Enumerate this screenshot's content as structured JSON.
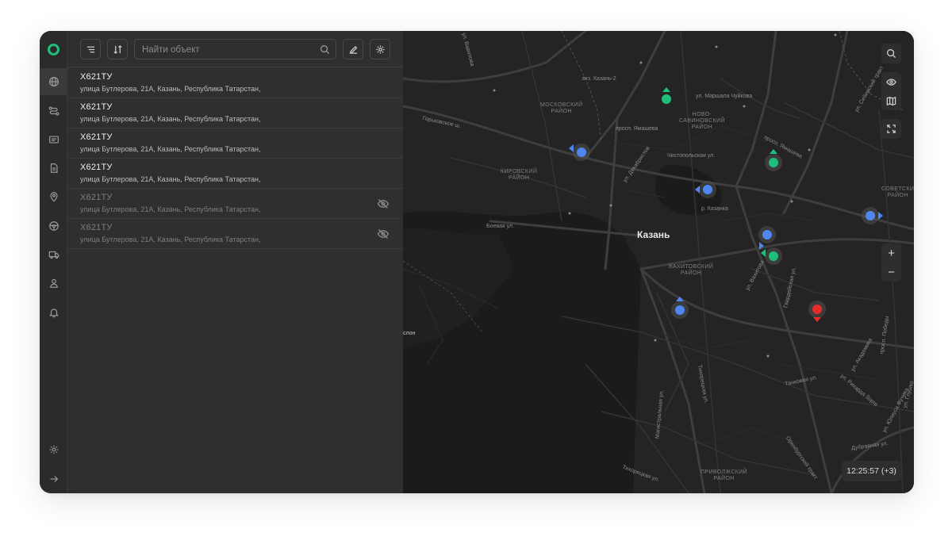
{
  "search": {
    "placeholder": "Найти объект",
    "value": ""
  },
  "objects": [
    {
      "plate": "Х621ТУ",
      "address": "улица Бутлерова, 21А, Казань, Республика Татарстан,",
      "hidden": false
    },
    {
      "plate": "Х621ТУ",
      "address": "улица Бутлерова, 21А, Казань, Республика Татарстан,",
      "hidden": false
    },
    {
      "plate": "Х621ТУ",
      "address": "улица Бутлерова, 21А, Казань, Республика Татарстан,",
      "hidden": false
    },
    {
      "plate": "Х621ТУ",
      "address": "улица Бутлерова, 21А, Казань, Республика Татарстан,",
      "hidden": false
    },
    {
      "plate": "Х621ТУ",
      "address": "улица Бутлерова, 21А, Казань, Республика Татарстан,",
      "hidden": true
    },
    {
      "plate": "Х621ТУ",
      "address": "улица Бутлерова, 21А, Казань, Республика Татарстан,",
      "hidden": true
    }
  ],
  "map": {
    "city": "Казань",
    "districts": {
      "moskovsky": "МОСКОВСКИЙ\nРАЙОН",
      "novo_savinovsky": "НОВО-\nСАВИНОВСКИЙ\nРАЙОН",
      "kirovsky": "КИРОВСКИЙ\nРАЙОН",
      "vakhitovsky": "ВАХИТОВСКИЙ\nРАЙОН",
      "sovetsky": "СОВЕТСКИ\nРАЙОН",
      "privolzhsky": "ПРИВОЛЖСКИЙ\nРАЙОН"
    },
    "streets": {
      "station": "вкз. Казань-2",
      "marshala": "ул. Маршала Чуйкова",
      "gorkovskoe": "Горьковское ш.",
      "yamasheva": "просп. Ямашева",
      "chistopolskaya": "Чистопольская ул.",
      "yamasheva2": "просп. Ямашева",
      "kazanka": "р. Казанка",
      "boevaya": "Боевая ул.",
      "slon": "слон",
      "dekabristov": "ул. Декабристов",
      "vakhitova": "ул. Вахитова",
      "gvardeyskaya": "Гвардейская ул.",
      "pobedy": "просп. Победы",
      "tankovaya": "Танковая ул.",
      "magistralnaya": "Магистральная ул.",
      "tihoretskaya": "Тихорецкая ул.",
      "dubravnaya": "Дубравная ул.",
      "orenburgsky": "Оренбургский тракт",
      "sibirsky": "ул. Сибирский тракт",
      "vavilova": "ул. Вавилова",
      "akademika": "ул. Академика",
      "yulius": "ул. Юлиуса Фучика",
      "rodinoy": "ул. Рихарда Зорге",
      "glushko": "ул. Глушко"
    },
    "vehicles": [
      {
        "color": "#1fbf7a"
      },
      {
        "color": "#1fbf7a"
      },
      {
        "color": "#4f86f0"
      },
      {
        "color": "#4f86f0"
      },
      {
        "color": "#4f86f0"
      },
      {
        "color": "#4f86f0"
      },
      {
        "color": "#1fbf7a"
      },
      {
        "color": "#4f86f0"
      },
      {
        "color": "#e52b2b"
      }
    ]
  },
  "clock": "12:25:57 (+3)",
  "colors": {
    "accent": "#1fbf7a",
    "vehicle_blue": "#4f86f0",
    "vehicle_green": "#1fbf7a",
    "vehicle_red": "#e52b2b"
  }
}
